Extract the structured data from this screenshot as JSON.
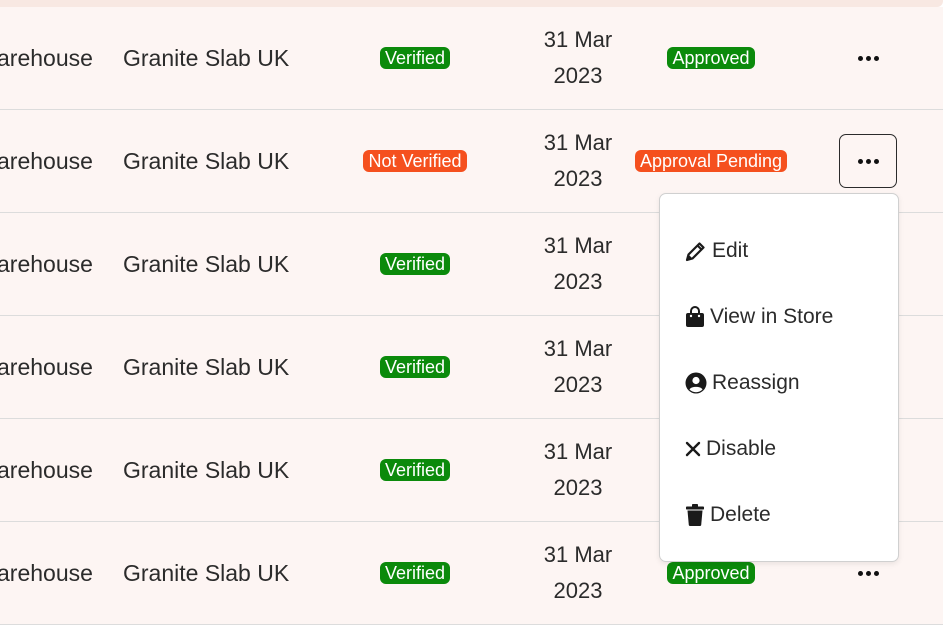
{
  "rows": [
    {
      "warehouse": "arehouse",
      "supplier": "Granite Slab UK",
      "verification": "Verified",
      "date_line1": "31 Mar",
      "date_line2": "2023",
      "approval": "Approved"
    },
    {
      "warehouse": "arehouse",
      "supplier": "Granite Slab UK",
      "verification": "Not Verified",
      "date_line1": "31 Mar",
      "date_line2": "2023",
      "approval": "Approval Pending"
    },
    {
      "warehouse": "arehouse",
      "supplier": "Granite Slab UK",
      "verification": "Verified",
      "date_line1": "31 Mar",
      "date_line2": "2023",
      "approval": ""
    },
    {
      "warehouse": "arehouse",
      "supplier": "Granite Slab UK",
      "verification": "Verified",
      "date_line1": "31 Mar",
      "date_line2": "2023",
      "approval": ""
    },
    {
      "warehouse": "arehouse",
      "supplier": "Granite Slab UK",
      "verification": "Verified",
      "date_line1": "31 Mar",
      "date_line2": "2023",
      "approval": ""
    },
    {
      "warehouse": "arehouse",
      "supplier": "Granite Slab UK",
      "verification": "Verified",
      "date_line1": "31 Mar",
      "date_line2": "2023",
      "approval": "Approved"
    }
  ],
  "action_menu": {
    "items": [
      {
        "label": "Edit",
        "icon": "pencil-icon"
      },
      {
        "label": "View in Store",
        "icon": "shopping-bag-icon"
      },
      {
        "label": "Reassign",
        "icon": "user-circle-icon"
      },
      {
        "label": "Disable",
        "icon": "x-icon"
      },
      {
        "label": "Delete",
        "icon": "trash-icon"
      }
    ]
  },
  "colors": {
    "verified": "#0b8a0b",
    "not_verified": "#f5501e",
    "row_background": "#fdf5f3"
  }
}
